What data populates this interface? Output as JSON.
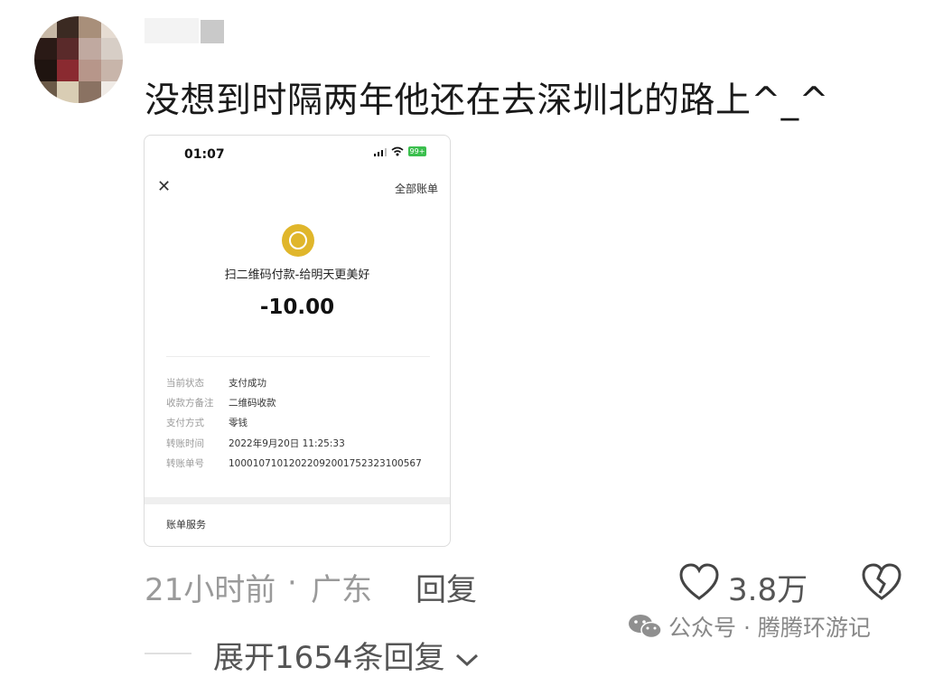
{
  "comment": {
    "text": "没想到时隔两年他还在去深圳北的路上^_^",
    "time": "21小时前",
    "dot": "·",
    "location": "广东",
    "reply_label": "回复",
    "likes": "3.8万",
    "expand_label": "展开1654条回复"
  },
  "payment_screenshot": {
    "status_time": "01:07",
    "battery": "99+",
    "all_bills": "全部账单",
    "merchant": "扫二维码付款-给明天更美好",
    "amount": "-10.00",
    "details": [
      {
        "key": "当前状态",
        "value": "支付成功"
      },
      {
        "key": "收款方备注",
        "value": "二维码收款"
      },
      {
        "key": "支付方式",
        "value": "零钱"
      },
      {
        "key": "转账时间",
        "value": "2022年9月20日 11:25:33"
      },
      {
        "key": "转账单号",
        "value": "1000107101202209200175232310056​7"
      }
    ],
    "service": "账单服务"
  },
  "watermark": {
    "text": "公众号 · 腾腾环游记"
  },
  "colors": {
    "coin": "#e0b62b",
    "battery": "#3bbf4e",
    "meta": "#9a9a9a"
  }
}
